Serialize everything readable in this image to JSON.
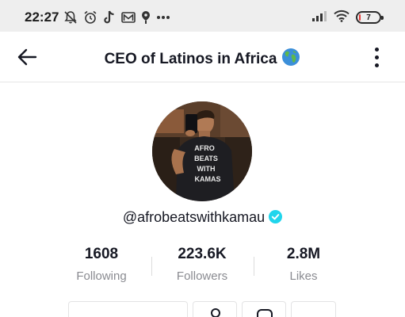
{
  "status_bar": {
    "time": "22:27",
    "battery_level": "7",
    "battery_fraction": 0.07,
    "left_icons": [
      "mute-bell-icon",
      "alarm-icon",
      "tiktok-icon",
      "gmail-icon",
      "location-icon",
      "more-notifications-icon"
    ],
    "right_icons": [
      "signal-icon",
      "wifi-icon",
      "battery-icon"
    ]
  },
  "header": {
    "title": "CEO of Latinos in Africa",
    "title_emoji_icon": "globe-icon",
    "back_icon": "arrow-left-icon",
    "menu_icon": "more-vertical-icon"
  },
  "profile": {
    "username": "@afrobeatswithkamau",
    "verified_icon": "verified-badge-icon",
    "verified_color": "#20d5ec",
    "shirt_text": [
      "AFRO",
      "BEATS",
      "WITH",
      "KAMAS"
    ]
  },
  "stats": [
    {
      "value": "1608",
      "label": "Following"
    },
    {
      "value": "223.6K",
      "label": "Followers"
    },
    {
      "value": "2.8M",
      "label": "Likes"
    }
  ]
}
